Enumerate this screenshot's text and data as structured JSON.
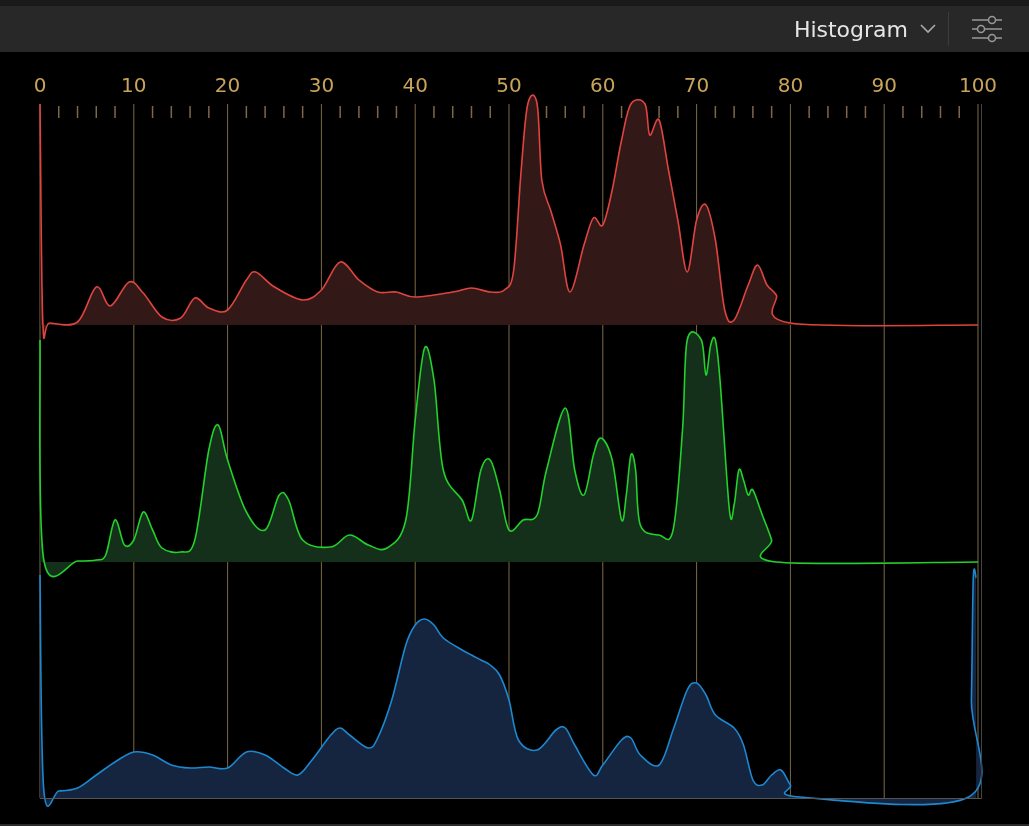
{
  "header": {
    "title": "Histogram"
  },
  "x_axis": {
    "labels": [
      "0",
      "10",
      "20",
      "30",
      "40",
      "50",
      "60",
      "70",
      "80",
      "90",
      "100"
    ]
  }
}
